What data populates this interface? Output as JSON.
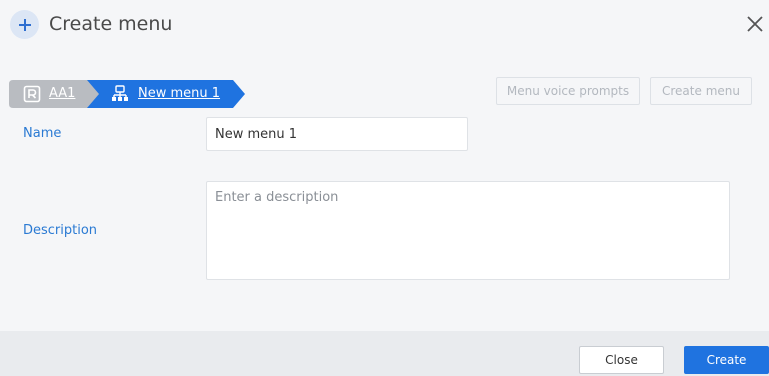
{
  "dialog": {
    "title": "Create menu",
    "icons": {
      "header": "plus-icon",
      "close": "close-icon"
    }
  },
  "breadcrumb": {
    "items": [
      {
        "label": "AA1",
        "icon": "auto-attendant-icon",
        "color": "#b9bcc1"
      },
      {
        "label": "New menu 1",
        "icon": "menu-tree-icon",
        "color": "#1f73e0"
      }
    ]
  },
  "toolbar": {
    "voice_prompts_label": "Menu voice prompts",
    "create_menu_label": "Create menu"
  },
  "form": {
    "name_label": "Name",
    "name_value": "New menu 1",
    "description_label": "Description",
    "description_placeholder": "Enter a description"
  },
  "footer": {
    "close_label": "Close",
    "create_label": "Create"
  },
  "colors": {
    "accent": "#1f73e0",
    "label_blue": "#2a7ad3"
  }
}
